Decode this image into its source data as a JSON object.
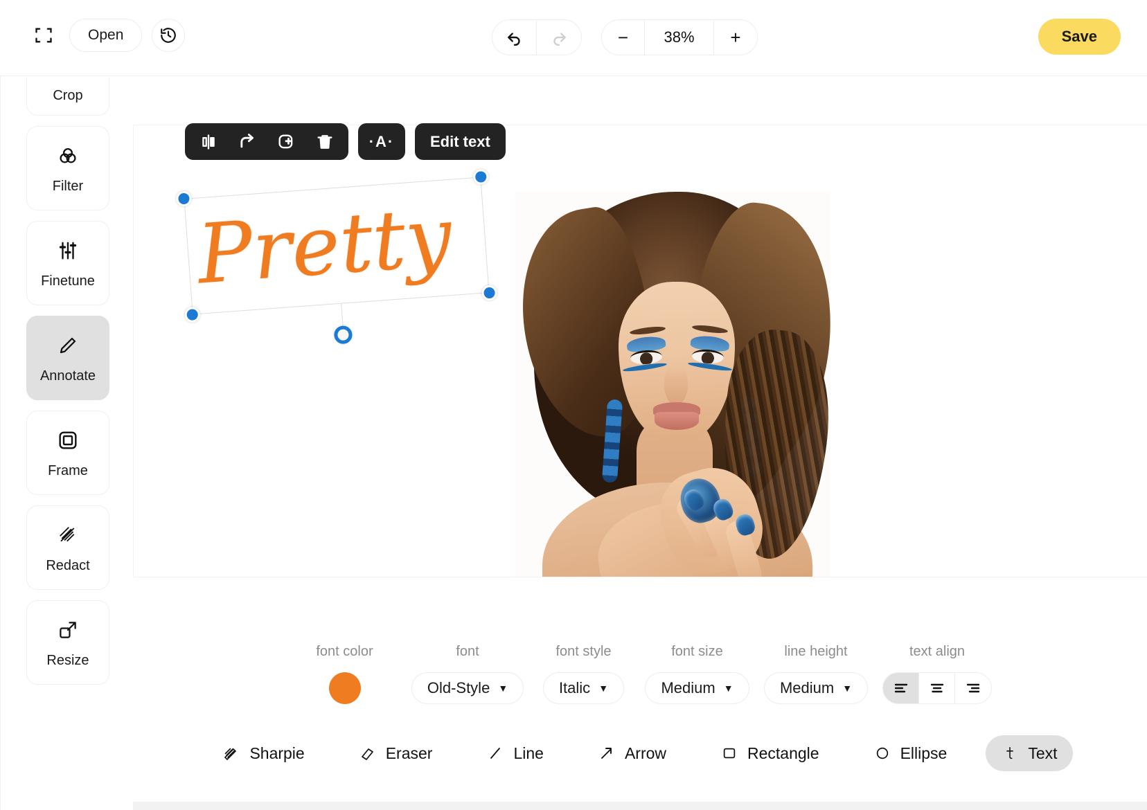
{
  "topbar": {
    "expand_icon": "expand-icon",
    "open_label": "Open",
    "history_icon": "history-revert-icon",
    "undo_icon": "undo-icon",
    "redo_icon": "redo-icon",
    "zoom_out_label": "−",
    "zoom_level": "38%",
    "zoom_in_label": "+",
    "save_label": "Save",
    "save_color": "#FADB5F"
  },
  "sidebar": {
    "items": [
      {
        "label": "Crop",
        "icon": "crop-icon",
        "active": false
      },
      {
        "label": "Filter",
        "icon": "filter-circles-icon",
        "active": false
      },
      {
        "label": "Finetune",
        "icon": "sliders-icon",
        "active": false
      },
      {
        "label": "Annotate",
        "icon": "pencil-icon",
        "active": true
      },
      {
        "label": "Frame",
        "icon": "frame-square-icon",
        "active": false
      },
      {
        "label": "Redact",
        "icon": "hatch-redact-icon",
        "active": false
      },
      {
        "label": "Resize",
        "icon": "resize-arrow-icon",
        "active": false
      }
    ]
  },
  "context_toolbar": {
    "buttons": [
      {
        "name": "flip-horizontal-icon"
      },
      {
        "name": "rotate-icon"
      },
      {
        "name": "duplicate-icon"
      },
      {
        "name": "delete-trash-icon"
      }
    ],
    "text_style_label": "·A·",
    "edit_text_label": "Edit text"
  },
  "canvas": {
    "text_object": {
      "content": "Pretty",
      "color": "#F07C22",
      "rotation_deg": -4.2,
      "selected": true
    },
    "photo_alt": "portrait-photo"
  },
  "options": {
    "font_color": {
      "label": "font color",
      "value": "#F07C22"
    },
    "font": {
      "label": "font",
      "value": "Old-Style"
    },
    "font_style": {
      "label": "font style",
      "value": "Italic"
    },
    "font_size": {
      "label": "font size",
      "value": "Medium"
    },
    "line_height": {
      "label": "line height",
      "value": "Medium"
    },
    "text_align": {
      "label": "text align",
      "options": [
        {
          "name": "align-left-icon",
          "active": true
        },
        {
          "name": "align-center-icon",
          "active": false
        },
        {
          "name": "align-right-icon",
          "active": false
        }
      ]
    }
  },
  "tools": [
    {
      "label": "Sharpie",
      "icon": "sharpie-icon",
      "active": false
    },
    {
      "label": "Eraser",
      "icon": "eraser-icon",
      "active": false
    },
    {
      "label": "Line",
      "icon": "line-icon",
      "active": false
    },
    {
      "label": "Arrow",
      "icon": "arrow-icon",
      "active": false
    },
    {
      "label": "Rectangle",
      "icon": "rectangle-icon",
      "active": false
    },
    {
      "label": "Ellipse",
      "icon": "ellipse-icon",
      "active": false
    },
    {
      "label": "Text",
      "icon": "text-t-icon",
      "active": true
    }
  ]
}
